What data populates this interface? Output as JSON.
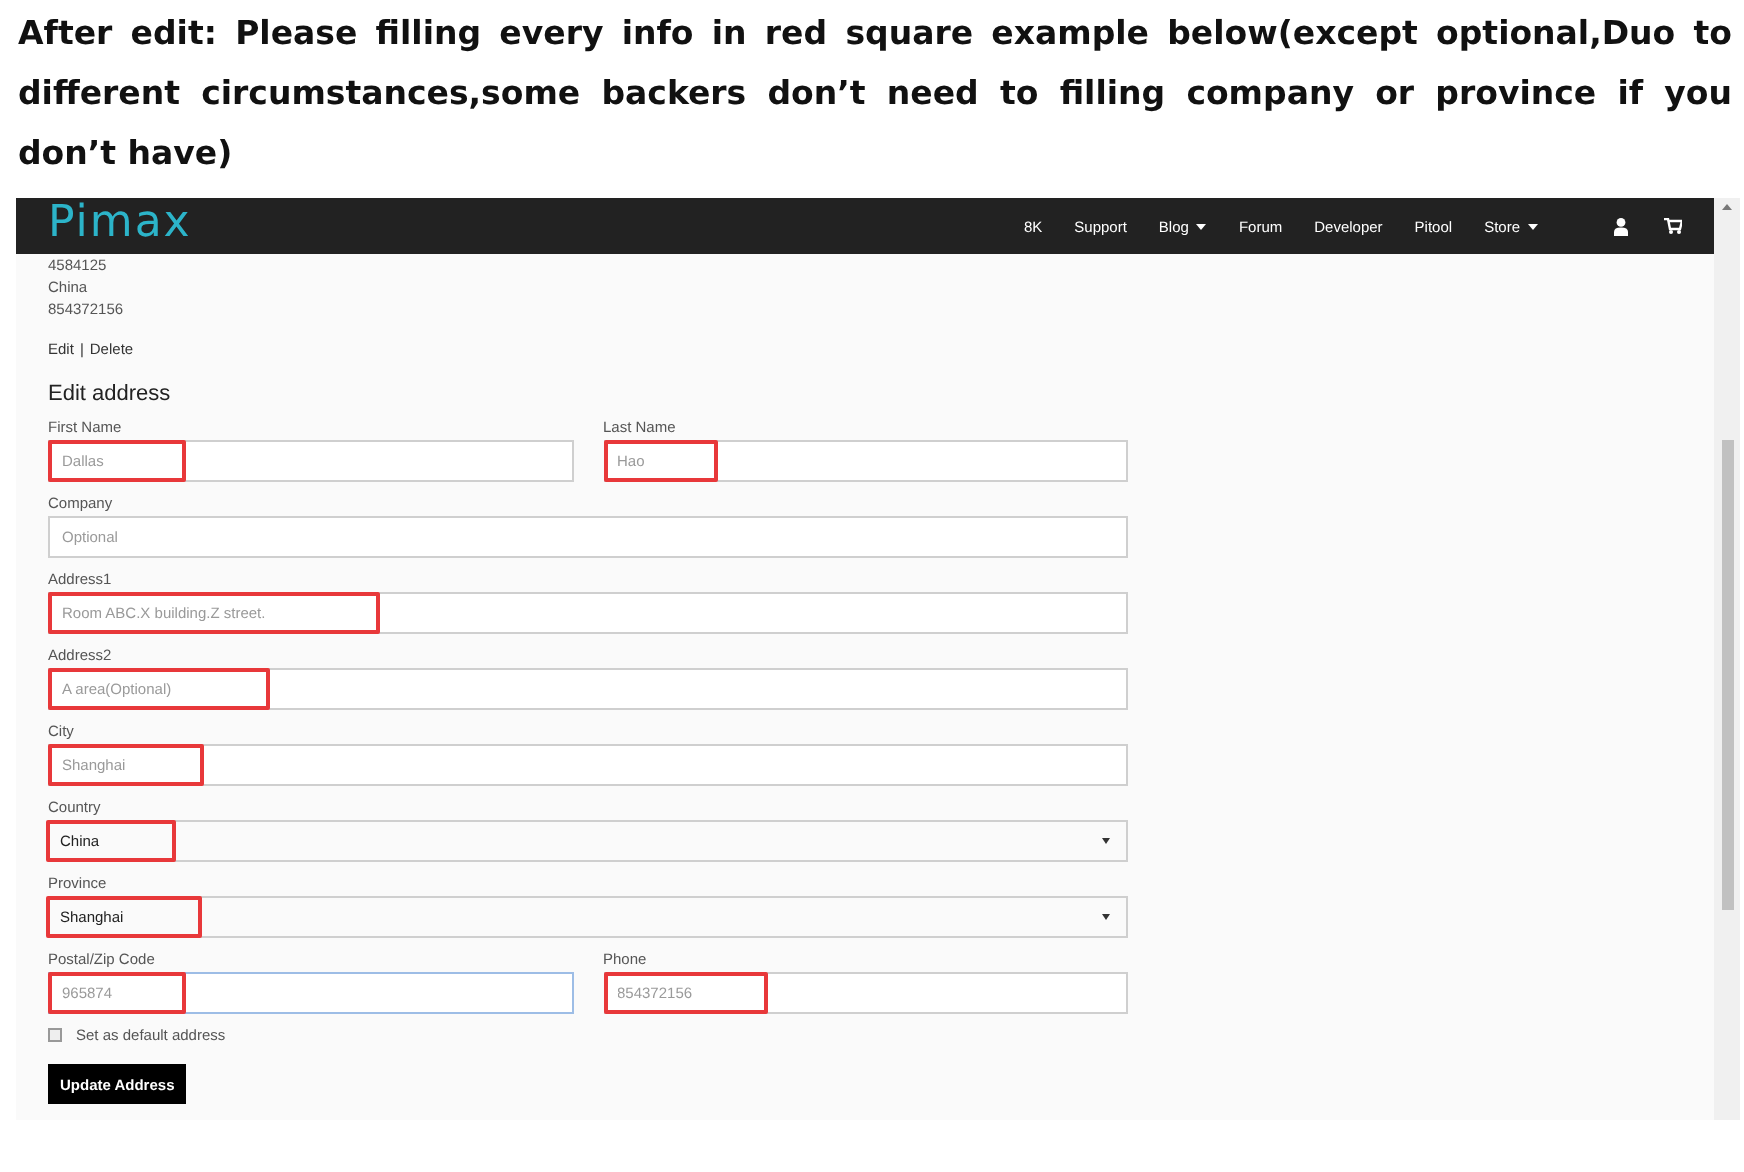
{
  "note": "After edit: Please filling every info in red square example below(except optional,Duo to different circumstances,some backers don’t need to filling company or province if you don’t have)",
  "nav": {
    "logo": "Pimax",
    "items": [
      {
        "label": "8K",
        "dropdown": false
      },
      {
        "label": "Support",
        "dropdown": false
      },
      {
        "label": "Blog",
        "dropdown": true
      },
      {
        "label": "Forum",
        "dropdown": false
      },
      {
        "label": "Developer",
        "dropdown": false
      },
      {
        "label": "Pitool",
        "dropdown": false
      },
      {
        "label": "Store",
        "dropdown": true
      }
    ]
  },
  "address_card": {
    "lines": [
      "4584125",
      "China",
      "854372156"
    ],
    "actions": [
      "Edit",
      "Delete"
    ],
    "separator": "|"
  },
  "form": {
    "title": "Edit address",
    "rows": [
      [
        {
          "label": "First Name",
          "kind": "text",
          "placeholder": "Dallas",
          "highlighted": true,
          "focused": false
        },
        {
          "label": "Last Name",
          "kind": "text",
          "placeholder": "Hao",
          "highlighted": true,
          "focused": false
        }
      ],
      [
        {
          "label": "Company",
          "kind": "text",
          "placeholder": "Optional",
          "highlighted": false,
          "focused": false
        }
      ],
      [
        {
          "label": "Address1",
          "kind": "text",
          "placeholder": "Room ABC.X building.Z street.",
          "highlighted": true,
          "focused": false
        }
      ],
      [
        {
          "label": "Address2",
          "kind": "text",
          "placeholder": "A area(Optional)",
          "highlighted": true,
          "focused": false
        }
      ],
      [
        {
          "label": "City",
          "kind": "text",
          "placeholder": "Shanghai",
          "highlighted": true,
          "focused": false
        }
      ],
      [
        {
          "label": "Country",
          "kind": "select",
          "value": "China",
          "highlighted": true,
          "focused": false
        }
      ],
      [
        {
          "label": "Province",
          "kind": "select",
          "value": "Shanghai",
          "highlighted": true,
          "focused": false
        }
      ],
      [
        {
          "label": "Postal/Zip Code",
          "kind": "text",
          "placeholder": "965874",
          "highlighted": true,
          "focused": true
        },
        {
          "label": "Phone",
          "kind": "text",
          "placeholder": "854372156",
          "highlighted": true,
          "focused": false
        }
      ]
    ],
    "default_checkbox": {
      "label": "Set as default address",
      "checked": false
    },
    "submit": "Update Address"
  }
}
